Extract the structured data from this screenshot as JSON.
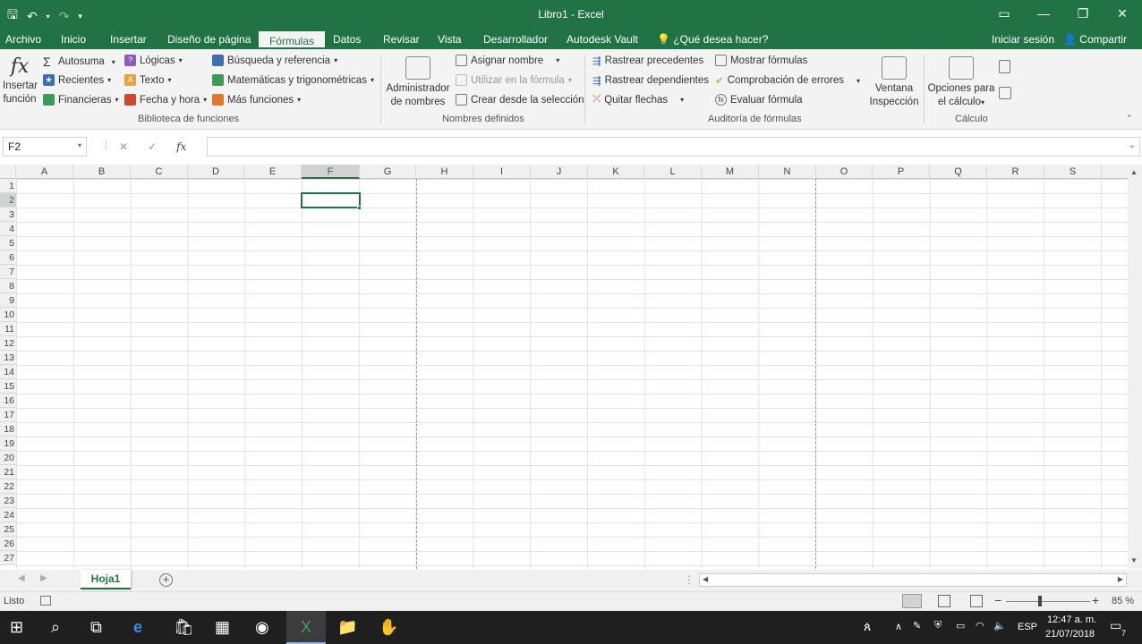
{
  "window": {
    "title": "Libro1 - Excel",
    "accent": "#217346"
  },
  "qat": {
    "save_icon": "save-icon",
    "undo_icon": "undo-icon",
    "redo_icon": "redo-icon"
  },
  "tabs": [
    "Archivo",
    "Inicio",
    "Insertar",
    "Diseño de página",
    "Fórmulas",
    "Datos",
    "Revisar",
    "Vista",
    "Desarrollador",
    "Autodesk Vault"
  ],
  "tell_me": "¿Qué desea hacer?",
  "account": {
    "signin": "Iniciar sesión",
    "share": "Compartir"
  },
  "ribbon": {
    "insert_fn": {
      "line1": "Insertar",
      "line2": "función"
    },
    "library": [
      "Autosuma",
      "Recientes",
      "Financieras",
      "Lógicas",
      "Texto",
      "Fecha y hora",
      "Búsqueda y referencia",
      "Matemáticas y trigonométricas",
      "Más funciones"
    ],
    "library_group": "Biblioteca de funciones",
    "name_manager": {
      "line1": "Administrador",
      "line2": "de nombres"
    },
    "names": [
      "Asignar nombre",
      "Utilizar en la fórmula",
      "Crear desde la selección"
    ],
    "names_group": "Nombres definidos",
    "audit": [
      "Rastrear precedentes",
      "Rastrear dependientes",
      "Quitar flechas",
      "Mostrar fórmulas",
      "Comprobación de errores",
      "Evaluar fórmula"
    ],
    "watch": {
      "line1": "Ventana",
      "line2": "Inspección"
    },
    "audit_group": "Auditoría de fórmulas",
    "calc_options": {
      "line1": "Opciones para",
      "line2": "el cálculo"
    },
    "calc_group": "Cálculo"
  },
  "formula_bar": {
    "name_box": "F2",
    "fx": "fx",
    "cancel": "✕",
    "enter": "✓",
    "value": ""
  },
  "sheet": {
    "columns": [
      "A",
      "B",
      "C",
      "D",
      "E",
      "F",
      "G",
      "H",
      "I",
      "J",
      "K",
      "L",
      "M",
      "N",
      "O",
      "P",
      "Q",
      "R",
      "S"
    ],
    "rows": [
      "1",
      "2",
      "3",
      "4",
      "5",
      "6",
      "7",
      "8",
      "9",
      "10",
      "11",
      "12",
      "13",
      "14",
      "15",
      "16",
      "17",
      "18",
      "19",
      "20",
      "21",
      "22",
      "23",
      "24",
      "25",
      "26",
      "27"
    ],
    "selected_column": "F",
    "selected_row": "2"
  },
  "sheet_tabs": [
    "Hoja1"
  ],
  "status": {
    "ready": "Listo",
    "zoom": "85 %"
  },
  "taskbar": {
    "lang": "ESP",
    "time": "12:47 a. m.",
    "date": "21/07/2018",
    "notifications": "7"
  }
}
